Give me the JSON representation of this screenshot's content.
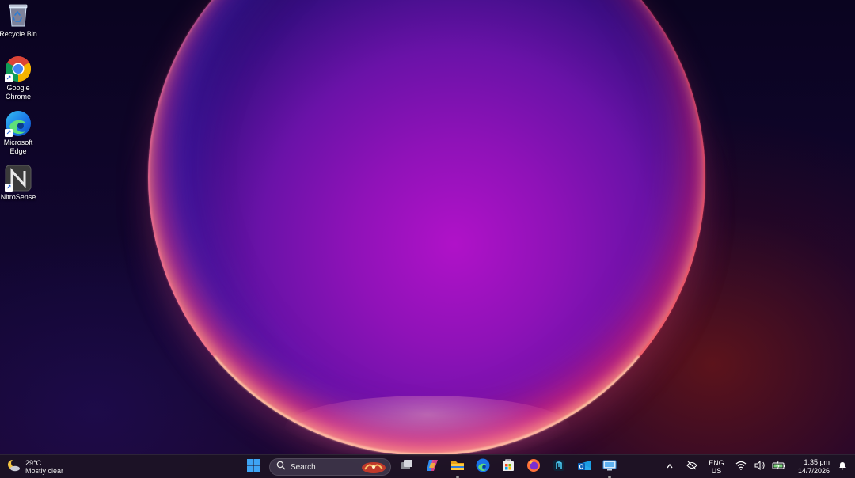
{
  "desktop": {
    "icons": [
      {
        "label": "Recycle Bin",
        "icon": "recycle-bin-icon"
      },
      {
        "label": "Google Chrome",
        "icon": "chrome-icon"
      },
      {
        "label": "Microsoft Edge",
        "icon": "edge-icon"
      },
      {
        "label": "NitroSense",
        "icon": "nitrosense-icon"
      }
    ]
  },
  "taskbar": {
    "weather": {
      "temp": "29°C",
      "desc": "Mostly clear",
      "icon": "moon-cloud-icon"
    },
    "search": {
      "label": "Search"
    },
    "apps": [
      {
        "name": "start",
        "icon": "windows-start-icon"
      },
      {
        "name": "task-view",
        "icon": "task-view-icon"
      },
      {
        "name": "copilot",
        "icon": "copilot-icon"
      },
      {
        "name": "file-explorer",
        "icon": "folder-icon"
      },
      {
        "name": "edge",
        "icon": "edge-icon"
      },
      {
        "name": "store",
        "icon": "store-icon"
      },
      {
        "name": "firefox",
        "icon": "firefox-icon"
      },
      {
        "name": "app",
        "icon": "dark-app-icon"
      },
      {
        "name": "outlook",
        "icon": "outlook-icon"
      },
      {
        "name": "remote-desktop",
        "icon": "remote-desktop-icon"
      }
    ],
    "tray": {
      "lang_line1": "ENG",
      "lang_line2": "US",
      "time": "1:35 pm",
      "date": "14/7/2026"
    }
  }
}
